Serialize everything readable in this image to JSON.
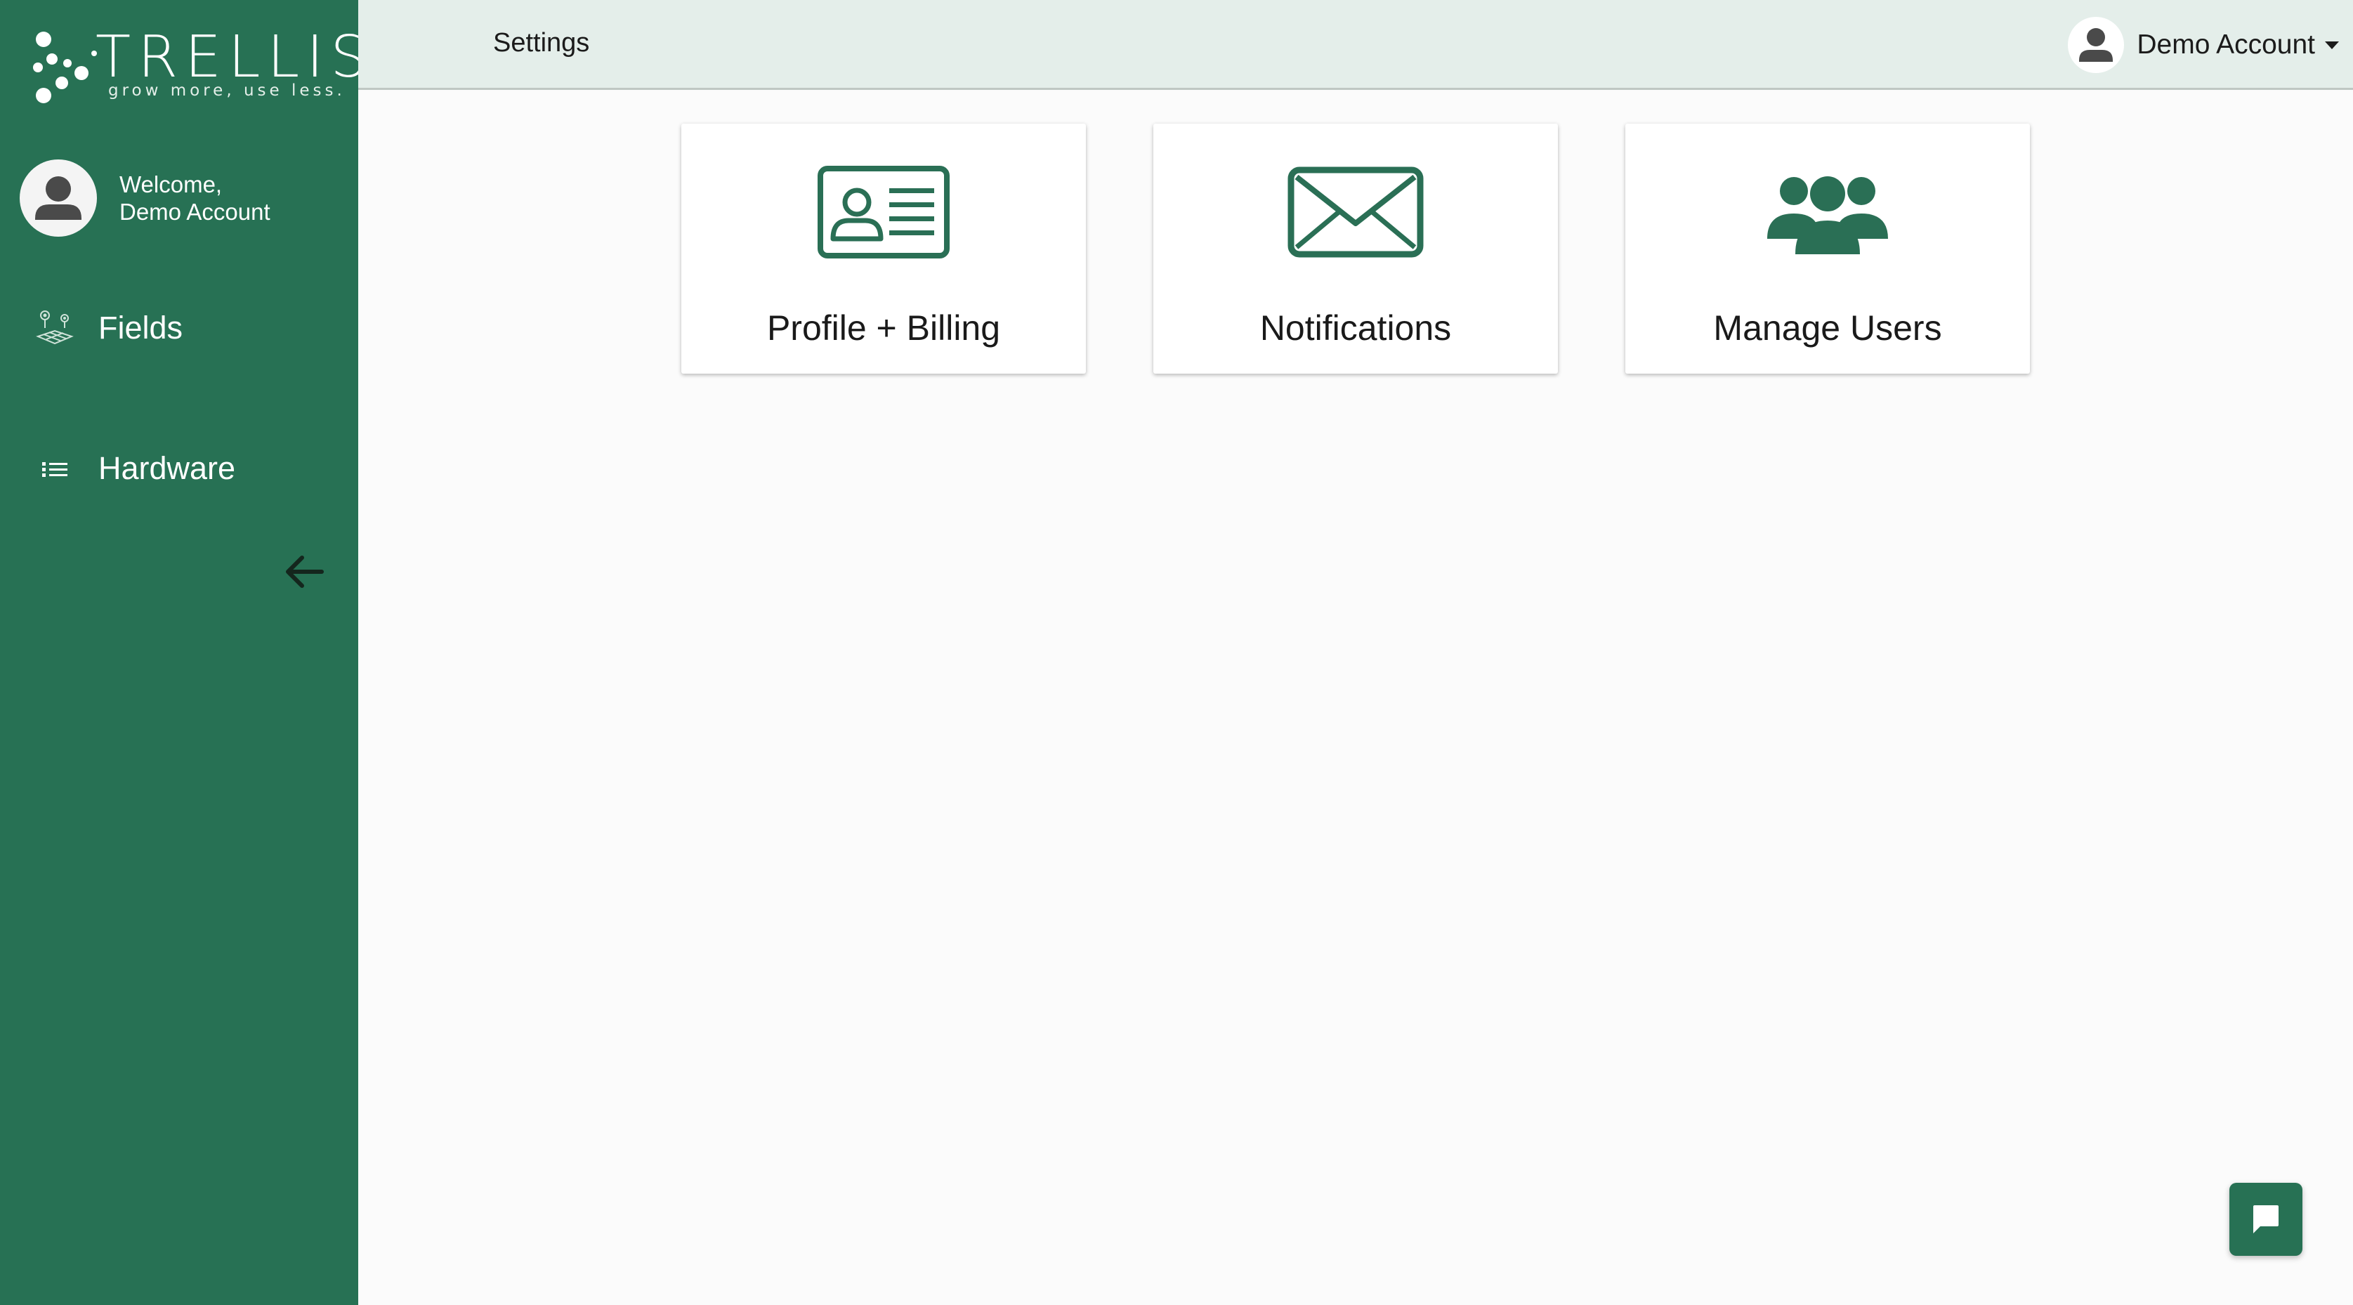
{
  "sidebar": {
    "logo": {
      "wordmark": "TRELLIS",
      "tagline": "grow more, use less."
    },
    "welcome": {
      "line1": "Welcome,",
      "line2": "Demo Account"
    },
    "items": [
      {
        "label": "Fields",
        "icon": "fields-map-icon"
      },
      {
        "label": "Hardware",
        "icon": "list-icon"
      }
    ],
    "collapse_icon": "arrow-left-icon",
    "background_color": "#277154"
  },
  "header": {
    "title": "Settings",
    "account_name": "Demo Account",
    "background_color": "#e4eeea"
  },
  "cards": [
    {
      "label": "Profile + Billing",
      "icon": "id-card-icon"
    },
    {
      "label": "Notifications",
      "icon": "envelope-icon"
    },
    {
      "label": "Manage Users",
      "icon": "users-group-icon"
    }
  ],
  "chat": {
    "icon": "chat-bubble-icon"
  },
  "colors": {
    "accent": "#277154",
    "icon_green": "#2a6f55"
  }
}
